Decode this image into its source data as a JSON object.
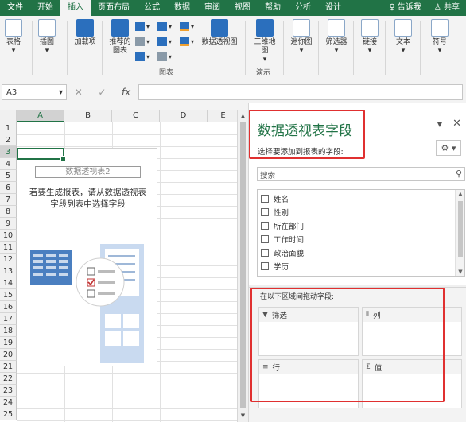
{
  "tabs": [
    "文件",
    "开始",
    "插入",
    "页面布局",
    "公式",
    "数据",
    "审阅",
    "视图",
    "帮助",
    "分析",
    "设计",
    "告诉我",
    "共享"
  ],
  "active_tab": "插入",
  "ribbon": {
    "table": "表格",
    "illustrations": "插图",
    "addins": "加载项",
    "recommended_charts": "推荐的图表",
    "pivot_chart": "数据透视图",
    "3d_map": "三维地图",
    "sparklines": "迷你图",
    "filter": "筛选器",
    "link": "链接",
    "text": "文本",
    "symbol": "符号",
    "charts_group": "图表",
    "tours_group": "演示"
  },
  "formula_bar": {
    "name_box": "A3",
    "fx": "fx",
    "cancel": "✕",
    "enter": "✓"
  },
  "grid": {
    "columns": [
      "A",
      "B",
      "C",
      "D",
      "E"
    ],
    "rows": [
      "1",
      "2",
      "3",
      "4",
      "5",
      "6",
      "7",
      "8",
      "9",
      "10",
      "11",
      "12",
      "13",
      "14",
      "15",
      "16",
      "17",
      "18",
      "19",
      "20",
      "21",
      "22",
      "23",
      "24",
      "25"
    ],
    "selected_cell": "A3"
  },
  "pivot_placeholder": {
    "name": "数据透视表2",
    "message_line1": "若要生成报表，请从数据透视表",
    "message_line2": "字段列表中选择字段"
  },
  "field_pane": {
    "title": "数据透视表字段",
    "subtitle": "选择要添加到报表的字段:",
    "search_placeholder": "搜索",
    "fields": [
      "姓名",
      "性别",
      "所在部门",
      "工作时间",
      "政治面貌",
      "学历"
    ],
    "drag_label": "在以下区域间拖动字段:",
    "zones": {
      "filter": "筛选",
      "columns": "列",
      "rows": "行",
      "values": "值"
    }
  },
  "colors": {
    "excel_green": "#217346",
    "highlight_red": "#e03030",
    "accent_blue": "#2b6fbd"
  }
}
